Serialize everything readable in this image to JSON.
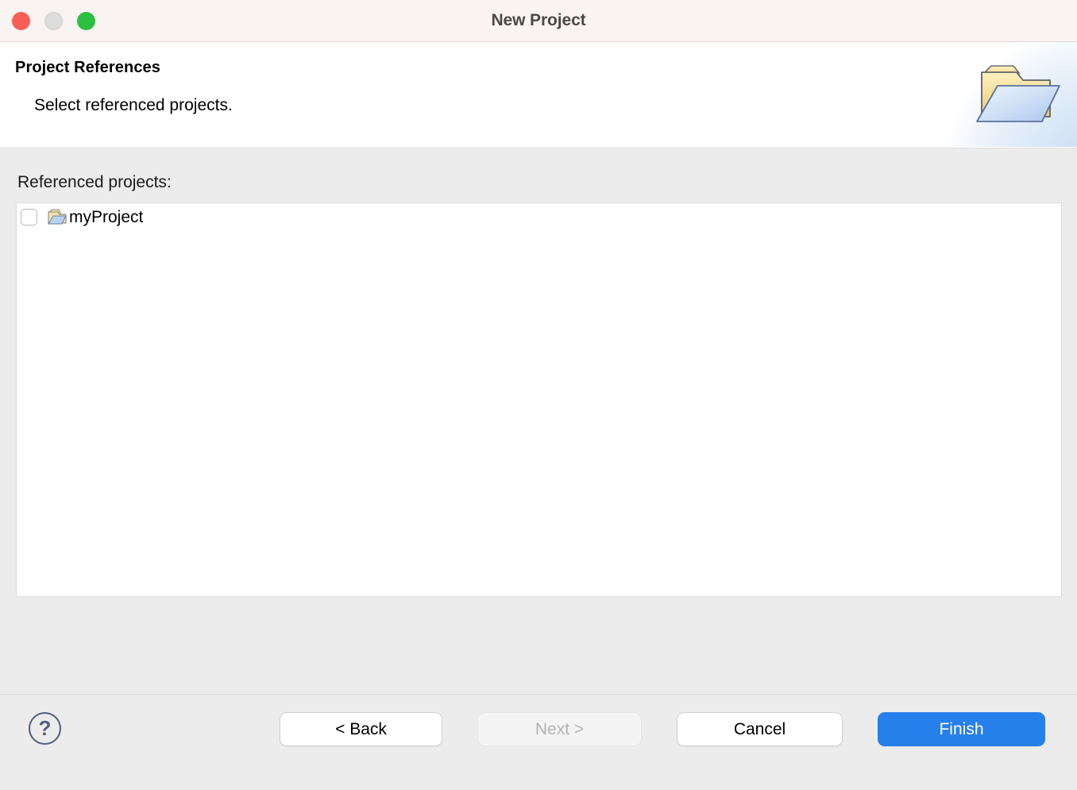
{
  "window": {
    "title": "New Project",
    "traffic_lights": [
      {
        "name": "close",
        "color": "#fa5e57"
      },
      {
        "name": "minimize",
        "color": "#dcdcdc"
      },
      {
        "name": "maximize",
        "color": "#2ac140"
      }
    ]
  },
  "header": {
    "title": "Project References",
    "subtitle": "Select referenced projects.",
    "art_icon": "open-folder-icon"
  },
  "main": {
    "list_label": "Referenced projects:",
    "items": [
      {
        "label": "myProject",
        "checked": false,
        "icon": "folder-icon"
      }
    ]
  },
  "footer": {
    "help_label": "?",
    "buttons": [
      {
        "name": "back",
        "label": "< Back",
        "style": "default",
        "enabled": true
      },
      {
        "name": "next",
        "label": "Next >",
        "style": "disabled",
        "enabled": false
      },
      {
        "name": "cancel",
        "label": "Cancel",
        "style": "default",
        "enabled": true
      },
      {
        "name": "finish",
        "label": "Finish",
        "style": "primary",
        "enabled": true
      }
    ]
  },
  "colors": {
    "titlebar_bg": "#f9f3f1",
    "header_bg": "#ffffff",
    "body_bg": "#ececec",
    "list_bg": "#ffffff",
    "primary_accent": "#2680eb",
    "help_icon": "#4f5d80"
  }
}
